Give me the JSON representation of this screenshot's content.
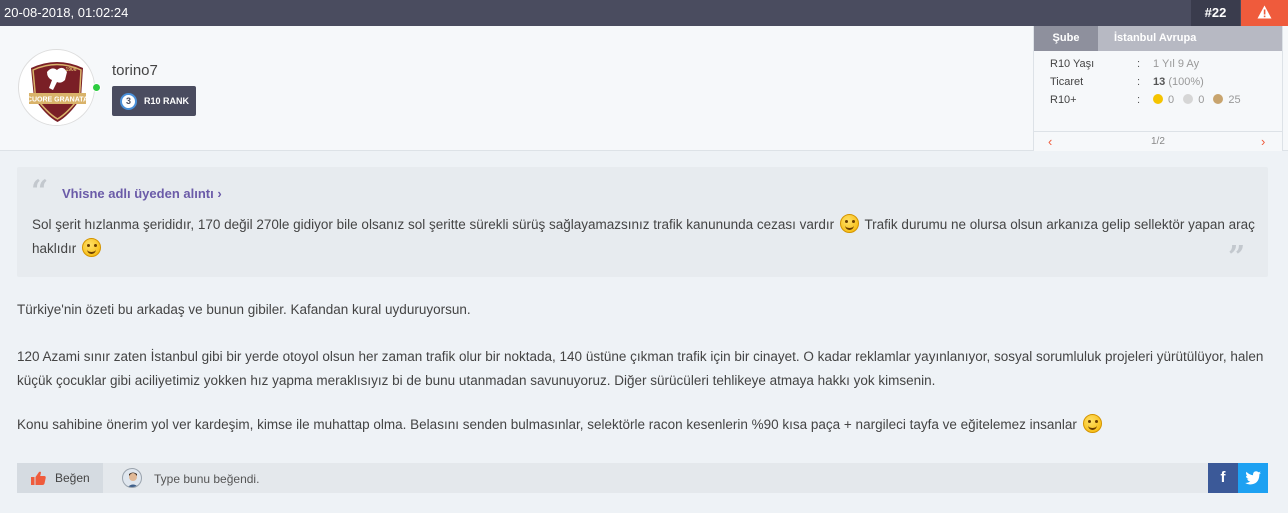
{
  "post": {
    "date": "20-08-2018, 01:02:24",
    "number": "#22"
  },
  "user": {
    "username": "torino7",
    "rank_level": "3",
    "rank_label": "R10 RANK",
    "avatar_year": "1906",
    "avatar_text": "CUORE GRANATA",
    "online": true
  },
  "infobox": {
    "tab_label": "Şube",
    "branch": "İstanbul Avrupa",
    "rows": [
      {
        "label": "R10 Yaşı",
        "value": "1 Yıl 9 Ay"
      },
      {
        "label": "Ticaret",
        "value_bold": "13",
        "value_extra": "(100%)"
      },
      {
        "label": "R10+",
        "gold": "0",
        "silver": "0",
        "bronze": "25"
      }
    ],
    "colon": ":",
    "page": "1/2",
    "prev_icon": "‹",
    "next_icon": "›"
  },
  "quote": {
    "author": "Vhisne adlı üyeden alıntı ›",
    "text_part1": "Sol şerit hızlanma şerididır, 170 değil 270le gidiyor bile olsanız sol şeritte sürekli sürüş sağlayamazsınız trafik kanununda cezası vardır",
    "text_part2": "Trafik durumu ne olursa olsun arkanıza gelip sellektör yapan araç haklıdır"
  },
  "body": {
    "p1": "Türkiye'nin özeti bu arkadaş ve bunun gibiler. Kafandan kural uyduruyorsun.",
    "p2": "120 Azami sınır zaten İstanbul gibi bir yerde otoyol olsun her zaman trafik olur bir noktada, 140 üstüne çıkman trafik için bir cinayet. O kadar reklamlar yayınlanıyor, sosyal sorumluluk projeleri yürütülüyor, halen küçük çocuklar gibi aciliyetimiz yokken hız yapma meraklısıyız bi de bunu utanmadan savunuyoruz. Diğer sürücüleri tehlikeye atmaya hakkı yok kimsenin.",
    "p3": "Konu sahibine önerim yol ver kardeşim, kimse ile muhattap olma. Belasını senden bulmasınlar, selektörle racon kesenlerin %90 kısa paça + nargileci tayfa ve eğitelemez insanlar"
  },
  "footer": {
    "like_label": "Beğen",
    "liked_text": "Type bunu beğendi.",
    "fb_label": "f"
  },
  "colors": {
    "topbar": "#4a4c5f",
    "report": "#ef5b3c",
    "quote_author": "#6b5ba8",
    "facebook": "#3b5998",
    "twitter": "#1da1f2",
    "gold": "#f5c400",
    "silver": "#d6d6d6",
    "bronze": "#c8a46e"
  },
  "icons": {
    "report": "warning-triangle-icon",
    "like": "thumbs-up-icon",
    "twitter": "twitter-bird-icon",
    "smiley": "smiley-emoji-icon"
  }
}
